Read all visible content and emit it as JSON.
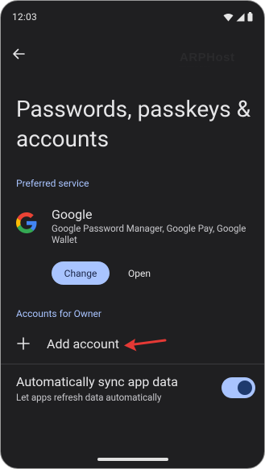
{
  "status_bar": {
    "time": "12:03",
    "icons": [
      "wifi-icon",
      "signal-icon",
      "battery-icon"
    ]
  },
  "header": {
    "back_icon": "arrow-left-icon",
    "watermark": "ARPHost",
    "watermark_sub": "···· ····· ·· ·· ·· ·"
  },
  "page": {
    "title": "Passwords, passkeys & accounts"
  },
  "preferred_service": {
    "section_label": "Preferred service",
    "logo_icon": "google-g-icon",
    "name": "Google",
    "description": "Google Password Manager, Google Pay, Google Wallet",
    "change_label": "Change",
    "open_label": "Open"
  },
  "accounts": {
    "section_label": "Accounts for Owner",
    "add_icon": "plus-icon",
    "add_label": "Add account",
    "annotation_icon": "red-arrow-icon"
  },
  "sync": {
    "title": "Automatically sync app data",
    "subtitle": "Let apps refresh data automatically",
    "enabled": true
  },
  "colors": {
    "background": "#1f1f21",
    "accent": "#a9c4ff",
    "toggle_knob": "#1e3a6e",
    "annotation_red": "#e53935"
  }
}
